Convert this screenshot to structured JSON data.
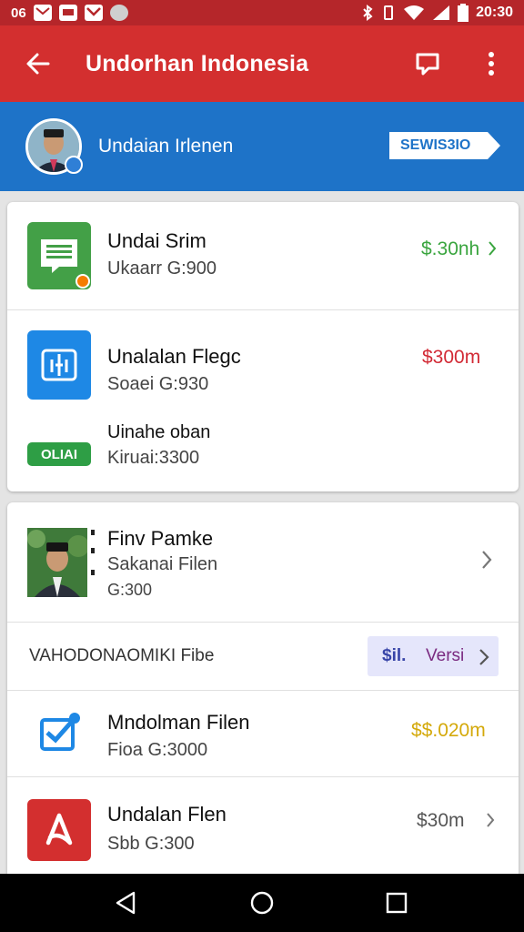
{
  "status_bar": {
    "left_text": "06",
    "time": "20:30",
    "icons": [
      "gmail-icon",
      "message-icon",
      "mail-icon",
      "circle-icon",
      "bluetooth-icon",
      "vibrate-icon",
      "wifi-icon",
      "signal-icon",
      "battery-icon"
    ]
  },
  "app_bar": {
    "title": "Undorhan Indonesia",
    "back_icon": "back-arrow-icon",
    "actions": [
      "chat-icon",
      "overflow-menu-icon"
    ]
  },
  "profile": {
    "name": "Undaian Irlenen",
    "button_label": "SEWIS3IO"
  },
  "card1": {
    "items": [
      {
        "title": "Undai Srim",
        "subtitle": "Ukaarr G:900",
        "price": "$.30nh",
        "price_color": "#3aa53f",
        "icon": "document-icon"
      },
      {
        "title": "Unalalan Flegc",
        "subtitle": "Soaei G:930",
        "price": "$300m",
        "price_color": "#d22a35",
        "icon": "building-icon"
      },
      {
        "title": "Uinahe oban",
        "subtitle": "Kiruai:3300",
        "tag": "OLIAI",
        "tag_color": "#2e9e45"
      }
    ]
  },
  "card2": {
    "person": {
      "title": "Finv Pamke",
      "subtitle": "Sakanai Filen",
      "meta": "G:300"
    },
    "section_label": "VAHODONAOMIKI Fibe",
    "section_chip": {
      "price": "$il.",
      "label": "Versi"
    },
    "items": [
      {
        "title": "Mndolman Filen",
        "subtitle": "Fioa G:3000",
        "price": "$$.020m",
        "price_color": "#d4a90a",
        "icon": "checkbox-icon"
      },
      {
        "title": "Undalan Flen",
        "subtitle": "Sbb G:300",
        "price": "$30m",
        "price_color": "#555555",
        "icon": "acrobat-icon"
      }
    ]
  },
  "colors": {
    "app_bar": "#d32f2f",
    "status_bar": "#b5262a",
    "profile_strip": "#1e73c8"
  }
}
